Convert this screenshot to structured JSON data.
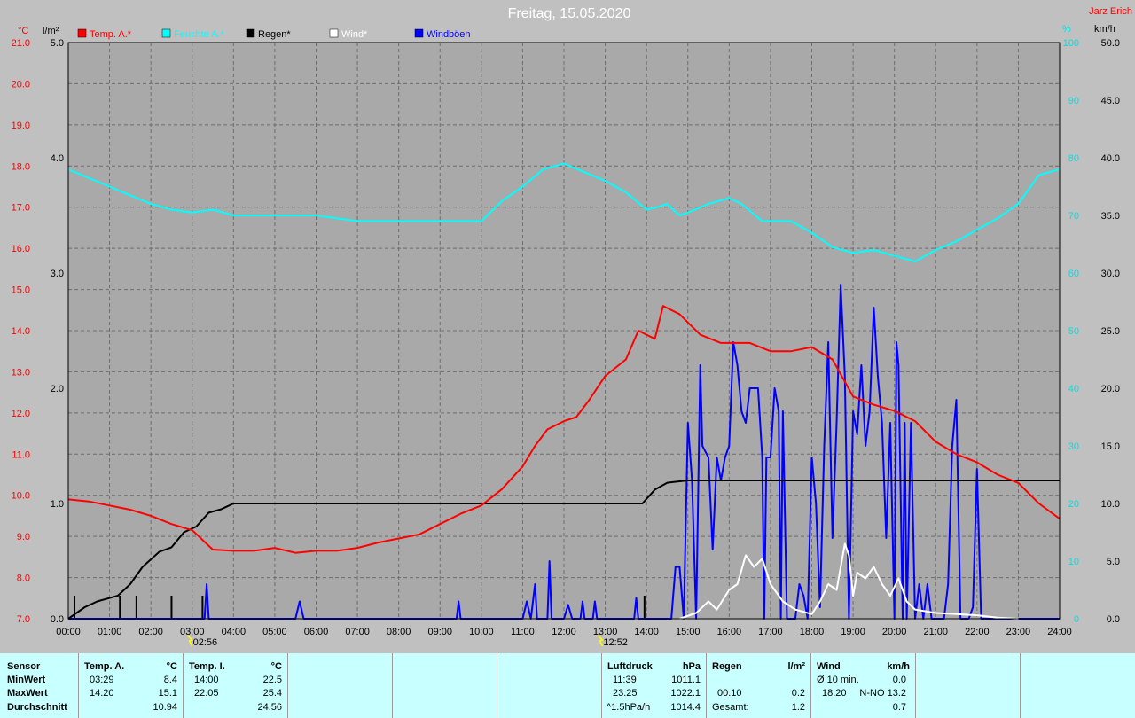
{
  "header": {
    "title": "Freitag, 15.05.2020",
    "station": "Jarz Erich",
    "left_units": [
      "°C",
      "l/m²"
    ],
    "right_units": [
      "%",
      "km/h"
    ]
  },
  "legend": [
    {
      "label": "Temp. A.*",
      "color": "#ff0000"
    },
    {
      "label": "Feuchte A.*",
      "color": "#00ffff"
    },
    {
      "label": "Regen*",
      "color": "#000000"
    },
    {
      "label": "Wind*",
      "color": "#ffffff"
    },
    {
      "label": "Windböen",
      "color": "#0000ff"
    }
  ],
  "markers": [
    "02:56",
    "12:52"
  ],
  "chart_data": {
    "type": "line",
    "x_unit": "hour",
    "xlim": [
      0,
      24
    ],
    "x_ticks": [
      "00:00",
      "01:00",
      "02:00",
      "03:00",
      "04:00",
      "05:00",
      "06:00",
      "07:00",
      "08:00",
      "09:00",
      "10:00",
      "11:00",
      "12:00",
      "13:00",
      "14:00",
      "15:00",
      "16:00",
      "17:00",
      "18:00",
      "19:00",
      "20:00",
      "21:00",
      "22:00",
      "23:00",
      "24:00"
    ],
    "axes": {
      "temperature": {
        "range": [
          7.0,
          21.0
        ],
        "ticks": [
          "7.0",
          "8.0",
          "9.0",
          "10.0",
          "11.0",
          "12.0",
          "13.0",
          "14.0",
          "15.0",
          "16.0",
          "17.0",
          "18.0",
          "19.0",
          "20.0",
          "21.0"
        ],
        "color": "#ff0000"
      },
      "rain": {
        "range": [
          0.0,
          5.0
        ],
        "ticks": [
          "0.0",
          "1.0",
          "2.0",
          "3.0",
          "4.0",
          "5.0"
        ],
        "color": "#000000"
      },
      "humidity": {
        "range": [
          0,
          100
        ],
        "ticks": [
          "0",
          "10",
          "20",
          "30",
          "40",
          "50",
          "60",
          "70",
          "80",
          "90",
          "100"
        ],
        "color": "#00e0e0"
      },
      "wind": {
        "range": [
          0.0,
          50.0
        ],
        "ticks": [
          "0.0",
          "5.0",
          "10.0",
          "15.0",
          "20.0",
          "25.0",
          "30.0",
          "35.0",
          "40.0",
          "45.0",
          "50.0"
        ],
        "color": "#000000"
      }
    },
    "series": [
      {
        "name": "Temp. A.*",
        "axis": "temperature",
        "color": "#ff0000",
        "points": [
          [
            0,
            9.9
          ],
          [
            0.5,
            9.85
          ],
          [
            1,
            9.75
          ],
          [
            1.5,
            9.65
          ],
          [
            2,
            9.5
          ],
          [
            2.5,
            9.3
          ],
          [
            3,
            9.15
          ],
          [
            3.5,
            8.68
          ],
          [
            4,
            8.65
          ],
          [
            4.5,
            8.65
          ],
          [
            5,
            8.72
          ],
          [
            5.5,
            8.6
          ],
          [
            6,
            8.65
          ],
          [
            6.5,
            8.65
          ],
          [
            7,
            8.72
          ],
          [
            7.5,
            8.85
          ],
          [
            8,
            8.95
          ],
          [
            8.5,
            9.05
          ],
          [
            9,
            9.3
          ],
          [
            9.5,
            9.55
          ],
          [
            10,
            9.75
          ],
          [
            10.5,
            10.15
          ],
          [
            11,
            10.7
          ],
          [
            11.3,
            11.2
          ],
          [
            11.6,
            11.6
          ],
          [
            12,
            11.8
          ],
          [
            12.3,
            11.9
          ],
          [
            12.6,
            12.3
          ],
          [
            13,
            12.9
          ],
          [
            13.5,
            13.3
          ],
          [
            13.8,
            14.0
          ],
          [
            14.2,
            13.8
          ],
          [
            14.4,
            14.6
          ],
          [
            14.8,
            14.4
          ],
          [
            15.3,
            13.9
          ],
          [
            15.8,
            13.7
          ],
          [
            16.5,
            13.7
          ],
          [
            17,
            13.5
          ],
          [
            17.5,
            13.5
          ],
          [
            18,
            13.6
          ],
          [
            18.5,
            13.3
          ],
          [
            19,
            12.4
          ],
          [
            19.5,
            12.2
          ],
          [
            20,
            12.05
          ],
          [
            20.5,
            11.8
          ],
          [
            21,
            11.3
          ],
          [
            21.5,
            11.0
          ],
          [
            22,
            10.8
          ],
          [
            22.5,
            10.5
          ],
          [
            23,
            10.3
          ],
          [
            23.5,
            9.8
          ],
          [
            24,
            9.43
          ]
        ]
      },
      {
        "name": "Feuchte A.*",
        "axis": "humidity",
        "color": "#00ffff",
        "points": [
          [
            0,
            78
          ],
          [
            0.5,
            76.5
          ],
          [
            1,
            75
          ],
          [
            1.5,
            73.5
          ],
          [
            2,
            72
          ],
          [
            2.5,
            71
          ],
          [
            3,
            70.5
          ],
          [
            3.5,
            71
          ],
          [
            4,
            70
          ],
          [
            5,
            70
          ],
          [
            6,
            70
          ],
          [
            6.5,
            69.5
          ],
          [
            7,
            69
          ],
          [
            8,
            69
          ],
          [
            9,
            69
          ],
          [
            10,
            69
          ],
          [
            10.5,
            72.5
          ],
          [
            11,
            75
          ],
          [
            11.5,
            78
          ],
          [
            12,
            79
          ],
          [
            12.5,
            77.5
          ],
          [
            13,
            76
          ],
          [
            13.5,
            74
          ],
          [
            14,
            71
          ],
          [
            14.3,
            71.5
          ],
          [
            14.5,
            72
          ],
          [
            14.8,
            70
          ],
          [
            15,
            70.5
          ],
          [
            15.5,
            72
          ],
          [
            16,
            73
          ],
          [
            16.3,
            72
          ],
          [
            16.8,
            69
          ],
          [
            17.5,
            69
          ],
          [
            18,
            67
          ],
          [
            18.5,
            64.5
          ],
          [
            19,
            63.5
          ],
          [
            19.5,
            64
          ],
          [
            20,
            63
          ],
          [
            20.5,
            62
          ],
          [
            21,
            64
          ],
          [
            21.5,
            65.5
          ],
          [
            22,
            67.5
          ],
          [
            22.5,
            69.5
          ],
          [
            23,
            72
          ],
          [
            23.5,
            77
          ],
          [
            24,
            78
          ]
        ]
      },
      {
        "name": "Regen*",
        "axis": "rain",
        "color": "#000000",
        "points": [
          [
            0,
            0
          ],
          [
            0.2,
            0.05
          ],
          [
            0.4,
            0.1
          ],
          [
            0.7,
            0.15
          ],
          [
            1.2,
            0.2
          ],
          [
            1.5,
            0.3
          ],
          [
            1.8,
            0.45
          ],
          [
            2.2,
            0.58
          ],
          [
            2.5,
            0.62
          ],
          [
            2.8,
            0.75
          ],
          [
            3.1,
            0.8
          ],
          [
            3.4,
            0.92
          ],
          [
            3.7,
            0.95
          ],
          [
            4,
            1.0
          ],
          [
            13.9,
            1.0
          ],
          [
            14.2,
            1.12
          ],
          [
            14.5,
            1.18
          ],
          [
            15,
            1.2
          ],
          [
            24,
            1.2
          ]
        ]
      },
      {
        "name": "Wind*",
        "axis": "wind",
        "color": "#ffffff",
        "points": [
          [
            14.8,
            0
          ],
          [
            15.2,
            0.5
          ],
          [
            15.5,
            1.5
          ],
          [
            15.7,
            0.8
          ],
          [
            16,
            2.5
          ],
          [
            16.2,
            3
          ],
          [
            16.4,
            5.5
          ],
          [
            16.6,
            4.5
          ],
          [
            16.8,
            5.2
          ],
          [
            17,
            3
          ],
          [
            17.3,
            1.5
          ],
          [
            17.6,
            0.8
          ],
          [
            18,
            0.4
          ],
          [
            18.2,
            1.5
          ],
          [
            18.4,
            3
          ],
          [
            18.6,
            2.5
          ],
          [
            18.8,
            6.5
          ],
          [
            18.9,
            5.5
          ],
          [
            19,
            2
          ],
          [
            19.1,
            4
          ],
          [
            19.3,
            3.5
          ],
          [
            19.5,
            4.5
          ],
          [
            19.7,
            3
          ],
          [
            19.9,
            2
          ],
          [
            20.1,
            3.5
          ],
          [
            20.3,
            1.5
          ],
          [
            20.5,
            0.8
          ],
          [
            21,
            0.5
          ],
          [
            21.5,
            0.4
          ],
          [
            22,
            0.3
          ],
          [
            22.5,
            0.1
          ],
          [
            23,
            0
          ]
        ]
      },
      {
        "name": "Windböen",
        "axis": "wind",
        "color": "#0000ff",
        "points": [
          [
            0,
            0
          ],
          [
            3.3,
            0
          ],
          [
            3.35,
            3
          ],
          [
            3.4,
            0
          ],
          [
            5.5,
            0
          ],
          [
            5.6,
            1.5
          ],
          [
            5.7,
            0
          ],
          [
            9.4,
            0
          ],
          [
            9.45,
            1.5
          ],
          [
            9.5,
            0
          ],
          [
            11,
            0
          ],
          [
            11.1,
            1.5
          ],
          [
            11.2,
            0
          ],
          [
            11.3,
            3
          ],
          [
            11.35,
            0
          ],
          [
            11.6,
            0
          ],
          [
            11.65,
            5
          ],
          [
            11.7,
            0
          ],
          [
            12,
            0
          ],
          [
            12.1,
            1.2
          ],
          [
            12.2,
            0
          ],
          [
            12.4,
            0
          ],
          [
            12.45,
            1.5
          ],
          [
            12.5,
            0
          ],
          [
            12.7,
            0
          ],
          [
            12.75,
            1.5
          ],
          [
            12.8,
            0
          ],
          [
            13.7,
            0
          ],
          [
            13.75,
            1.8
          ],
          [
            13.8,
            0
          ],
          [
            14.6,
            0
          ],
          [
            14.7,
            4.5
          ],
          [
            14.8,
            4.5
          ],
          [
            14.9,
            0
          ],
          [
            15.0,
            17
          ],
          [
            15.1,
            12
          ],
          [
            15.2,
            0
          ],
          [
            15.3,
            22
          ],
          [
            15.35,
            15
          ],
          [
            15.5,
            14
          ],
          [
            15.6,
            6
          ],
          [
            15.7,
            14
          ],
          [
            15.8,
            12
          ],
          [
            15.9,
            14
          ],
          [
            16,
            15
          ],
          [
            16.1,
            24
          ],
          [
            16.2,
            22
          ],
          [
            16.3,
            18
          ],
          [
            16.4,
            17
          ],
          [
            16.5,
            20
          ],
          [
            16.7,
            20
          ],
          [
            16.8,
            14
          ],
          [
            16.85,
            0
          ],
          [
            16.9,
            14
          ],
          [
            17.0,
            14
          ],
          [
            17.1,
            20
          ],
          [
            17.2,
            18
          ],
          [
            17.25,
            0
          ],
          [
            17.3,
            18
          ],
          [
            17.4,
            0
          ],
          [
            17.6,
            0
          ],
          [
            17.7,
            3
          ],
          [
            17.8,
            2
          ],
          [
            17.9,
            0
          ],
          [
            18.0,
            14
          ],
          [
            18.1,
            10
          ],
          [
            18.2,
            1
          ],
          [
            18.3,
            15
          ],
          [
            18.4,
            24
          ],
          [
            18.5,
            7
          ],
          [
            18.6,
            17
          ],
          [
            18.7,
            29
          ],
          [
            18.8,
            21
          ],
          [
            18.9,
            0
          ],
          [
            19,
            18
          ],
          [
            19.1,
            16
          ],
          [
            19.2,
            22
          ],
          [
            19.3,
            15
          ],
          [
            19.4,
            18
          ],
          [
            19.5,
            27
          ],
          [
            19.6,
            21
          ],
          [
            19.7,
            17
          ],
          [
            19.8,
            7
          ],
          [
            19.9,
            17
          ],
          [
            20,
            0
          ],
          [
            20.05,
            24
          ],
          [
            20.1,
            22
          ],
          [
            20.2,
            0
          ],
          [
            20.25,
            17
          ],
          [
            20.3,
            0
          ],
          [
            20.4,
            17
          ],
          [
            20.5,
            0
          ],
          [
            20.6,
            3
          ],
          [
            20.7,
            0
          ],
          [
            20.8,
            3
          ],
          [
            20.9,
            0
          ],
          [
            21.2,
            0
          ],
          [
            21.3,
            3
          ],
          [
            21.4,
            15
          ],
          [
            21.5,
            19
          ],
          [
            21.6,
            0
          ],
          [
            21.8,
            0
          ],
          [
            21.9,
            1
          ],
          [
            22,
            13
          ],
          [
            22.1,
            0
          ],
          [
            24,
            0
          ]
        ]
      }
    ],
    "rain_bars": [
      0.15,
      1.25,
      1.65,
      2.5,
      3.25,
      13.95
    ]
  },
  "stats": {
    "sensor": {
      "label": "Sensor",
      "rows": [
        "MinWert",
        "MaxWert",
        "Durchschnitt"
      ]
    },
    "temp_a": {
      "label": "Temp. A.",
      "unit": "°C",
      "rows": [
        {
          "time": "03:29",
          "value": "8.4"
        },
        {
          "time": "14:20",
          "value": "15.1"
        },
        {
          "time": "",
          "value": "10.94"
        }
      ]
    },
    "temp_i": {
      "label": "Temp. I.",
      "unit": "°C",
      "rows": [
        {
          "time": "14:00",
          "value": "22.5"
        },
        {
          "time": "22:05",
          "value": "25.4"
        },
        {
          "time": "",
          "value": "24.56"
        }
      ]
    },
    "pressure": {
      "label": "Luftdruck",
      "unit": "hPa",
      "rows": [
        {
          "time": "11:39",
          "value": "1011.1"
        },
        {
          "time": "23:25",
          "value": "1022.1"
        },
        {
          "time": "^1.5hPa/h",
          "value": "1014.4"
        }
      ]
    },
    "rain": {
      "label": "Regen",
      "unit": "l/m²",
      "rows": [
        {
          "time": "",
          "value": ""
        },
        {
          "time": "00:10",
          "value": "0.2"
        },
        {
          "time": "Gesamt:",
          "value": "1.2"
        }
      ]
    },
    "wind": {
      "label": "Wind",
      "unit": "km/h",
      "rows": [
        {
          "time": "Ø 10 min.",
          "value": "0.0"
        },
        {
          "time": "18:20",
          "value": "N-NO 13.2"
        },
        {
          "time": "",
          "value": "0.7"
        }
      ]
    }
  }
}
